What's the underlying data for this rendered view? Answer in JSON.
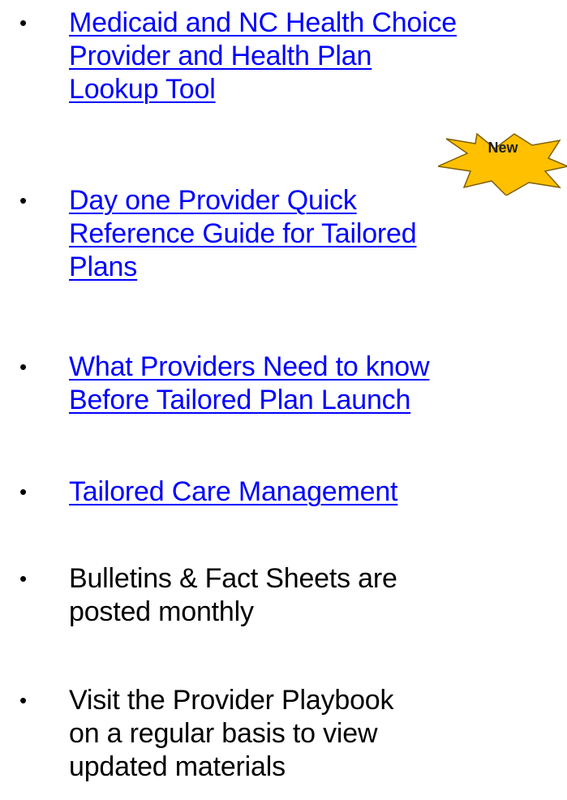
{
  "items": [
    {
      "lines": [
        "Medicaid and NC Health Choice",
        "Provider and Health Plan",
        "Lookup Tool"
      ]
    },
    {
      "lines": [
        "Day one Provider Quick",
        "Reference Guide for Tailored",
        "Plans"
      ]
    },
    {
      "lines": [
        "What Providers Need to know",
        "Before Tailored Plan Launch"
      ]
    },
    {
      "lines": [
        "Tailored Care Management"
      ]
    },
    {
      "lines": [
        "Bulletins & Fact Sheets are",
        "posted monthly"
      ]
    },
    {
      "lines": [
        "Visit the Provider Playbook",
        "on a regular basis to view",
        "updated materials"
      ]
    }
  ],
  "bullet_char": "•",
  "badge": {
    "label": "New",
    "fill": "#ffc000",
    "stroke": "#7f6000"
  },
  "colors": {
    "link": "#0000ff",
    "text": "#000000"
  }
}
